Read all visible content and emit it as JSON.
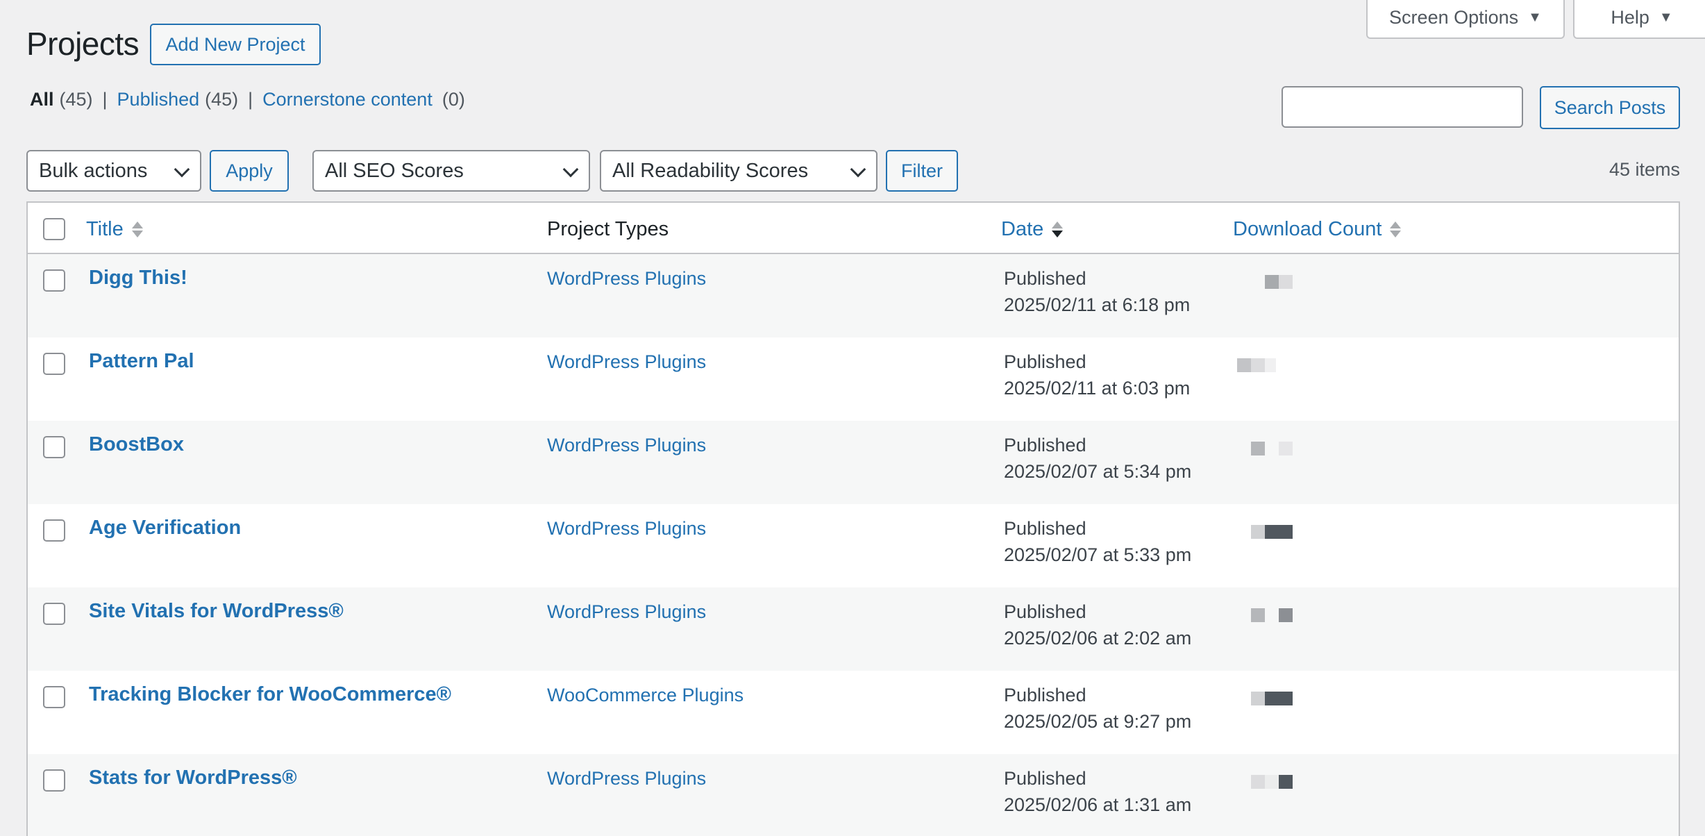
{
  "header": {
    "title": "Projects",
    "add_new": "Add New Project",
    "screen_options": "Screen Options",
    "help": "Help"
  },
  "views": {
    "all_label": "All",
    "all_count": "(45)",
    "published_label": "Published",
    "published_count": "(45)",
    "cornerstone_label": "Cornerstone content",
    "cornerstone_count": "(0)",
    "separator": "|"
  },
  "search": {
    "button": "Search Posts",
    "value": ""
  },
  "tablenav": {
    "bulk_actions": "Bulk actions",
    "apply": "Apply",
    "seo_filter": "All SEO Scores",
    "readability_filter": "All Readability Scores",
    "filter": "Filter",
    "items": "45 items"
  },
  "table": {
    "columns": {
      "title": "Title",
      "types": "Project Types",
      "date": "Date",
      "download": "Download Count"
    },
    "rows": [
      {
        "title": "Digg This!",
        "type": "WordPress Plugins",
        "status": "Published",
        "date": "2025/02/11 at 6:18 pm"
      },
      {
        "title": "Pattern Pal",
        "type": "WordPress Plugins",
        "status": "Published",
        "date": "2025/02/11 at 6:03 pm"
      },
      {
        "title": "BoostBox",
        "type": "WordPress Plugins",
        "status": "Published",
        "date": "2025/02/07 at 5:34 pm"
      },
      {
        "title": "Age Verification",
        "type": "WordPress Plugins",
        "status": "Published",
        "date": "2025/02/07 at 5:33 pm"
      },
      {
        "title": "Site Vitals for WordPress®",
        "type": "WordPress Plugins",
        "status": "Published",
        "date": "2025/02/06 at 2:02 am"
      },
      {
        "title": "Tracking Blocker for WooCommerce®",
        "type": "WooCommerce Plugins",
        "status": "Published",
        "date": "2025/02/05 at 9:27 pm"
      },
      {
        "title": "Stats for WordPress®",
        "type": "WordPress Plugins",
        "status": "Published",
        "date": "2025/02/06 at 1:31 am"
      }
    ]
  },
  "colors": {
    "accent": "#2271b1",
    "background": "#f0f0f1",
    "row_alt": "#f6f7f7"
  }
}
